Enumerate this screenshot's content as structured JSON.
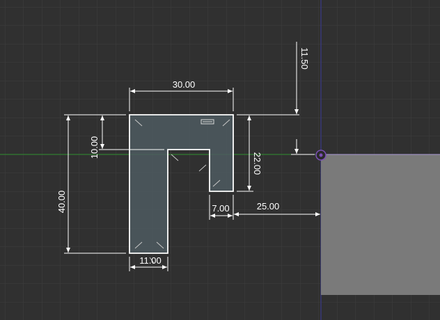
{
  "sketch": {
    "dimensions": {
      "top_width": "30.00",
      "total_height": "40.00",
      "flange_thickness": "10.00",
      "right_leg_height": "22.00",
      "right_leg_width": "7.00",
      "stem_width": "11.00",
      "offset_x": "25.00",
      "offset_y": "11.50"
    }
  },
  "colors": {
    "background": "#303030",
    "grid": "#3e3e3e",
    "profile_fill": "#4e5a60",
    "profile_edge": "#ffffff",
    "dimension": "#ffffff",
    "body_face": "#7a7a7a",
    "x_axis": "#2f8f2f",
    "y_axis": "#3a3a9a",
    "origin": "#7a4fb5"
  },
  "icons": {
    "origin": "origin-point-icon",
    "constraint": "perpendicular-constraint-icon",
    "fix": "fix-constraint-icon"
  }
}
